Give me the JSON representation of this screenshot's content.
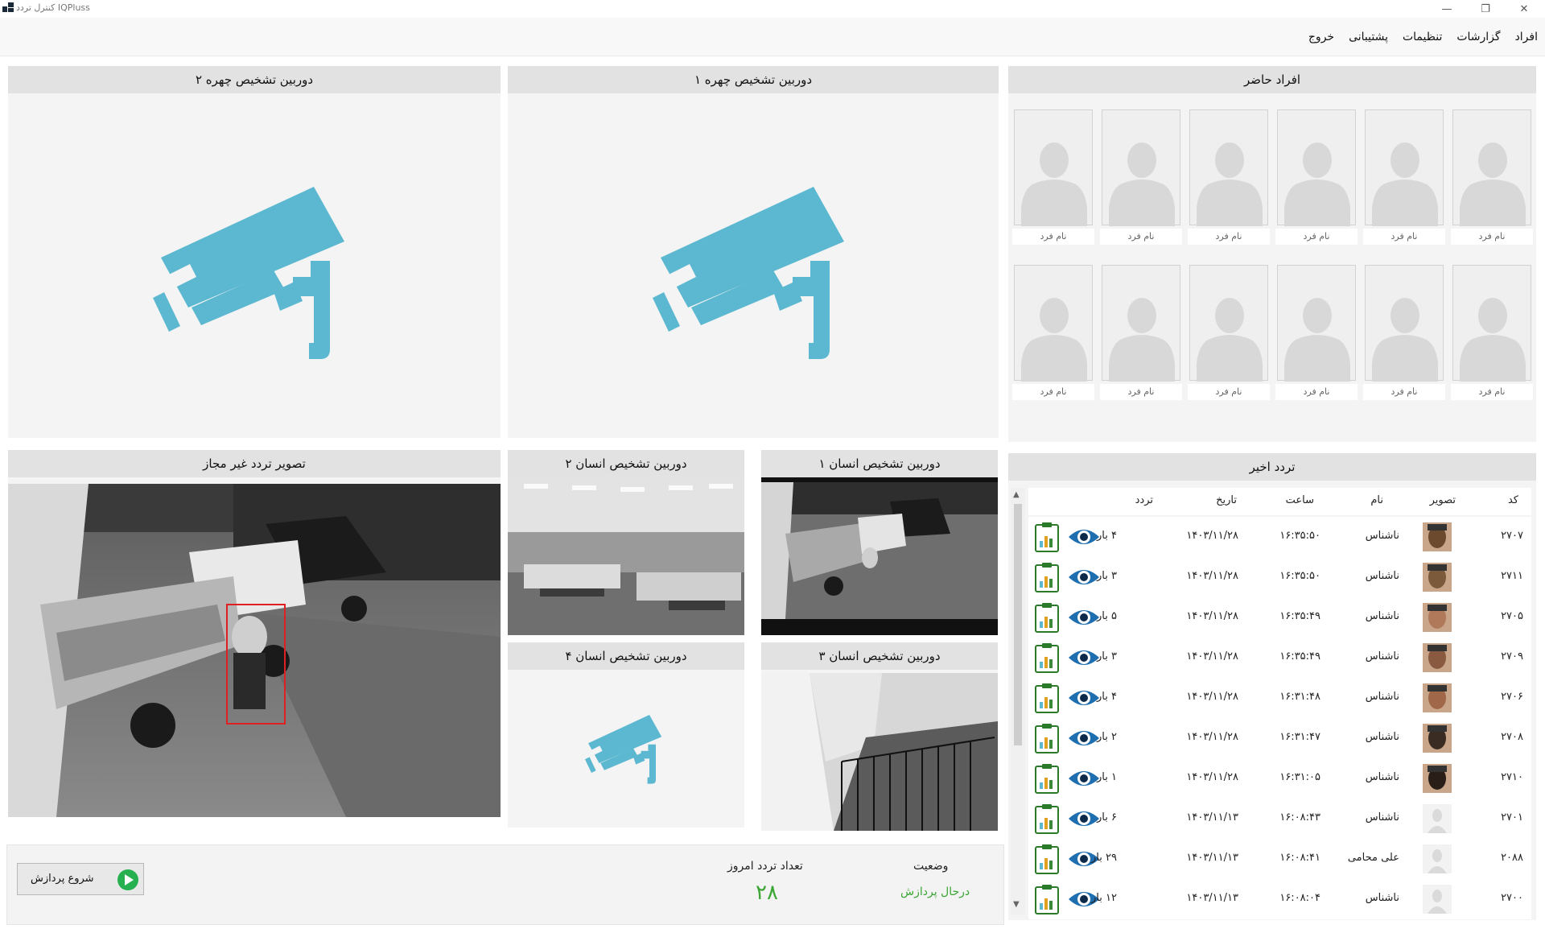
{
  "window": {
    "title": "IQPluss کنترل تردد",
    "minimize_icon": "minimize-icon",
    "restore_icon": "restore-icon",
    "close_icon": "close-icon"
  },
  "menu": {
    "items": [
      "افراد",
      "گزارشات",
      "تنظیمات",
      "پشتیبانی",
      "خروج"
    ]
  },
  "present_people": {
    "title": "افراد حاضر",
    "slots": [
      "نام فرد",
      "نام فرد",
      "نام فرد",
      "نام فرد",
      "نام فرد",
      "نام فرد",
      "نام فرد",
      "نام فرد",
      "نام فرد",
      "نام فرد",
      "نام فرد",
      "نام فرد"
    ]
  },
  "cameras": {
    "face1": "دوربین  تشخیص چهره ۱",
    "face2": "دوربین  تشخیص چهره ۲",
    "unauthorized": "تصویر تردد غیر مجاز",
    "human1": "دوربین تشخیص انسان ۱",
    "human2": "دوربین تشخیص انسان ۲",
    "human3": "دوربین تشخیص انسان ۳",
    "human4": "دوربین تشخیص انسان ۴"
  },
  "recent": {
    "title": "تردد اخیر",
    "columns": {
      "code": "کد",
      "photo": "تصویر",
      "name": "نام",
      "time": "ساعت",
      "date": "تاریخ",
      "count": "تردد"
    },
    "rows": [
      {
        "code": "۲۷۰۷",
        "name": "ناشناس",
        "time": "۱۶:۳۵:۵۰",
        "date": "۱۴۰۳/۱۱/۲۸",
        "count": "۴ بار"
      },
      {
        "code": "۲۷۱۱",
        "name": "ناشناس",
        "time": "۱۶:۳۵:۵۰",
        "date": "۱۴۰۳/۱۱/۲۸",
        "count": "۳ بار"
      },
      {
        "code": "۲۷۰۵",
        "name": "ناشناس",
        "time": "۱۶:۳۵:۴۹",
        "date": "۱۴۰۳/۱۱/۲۸",
        "count": "۵ بار"
      },
      {
        "code": "۲۷۰۹",
        "name": "ناشناس",
        "time": "۱۶:۳۵:۴۹",
        "date": "۱۴۰۳/۱۱/۲۸",
        "count": "۳ بار"
      },
      {
        "code": "۲۷۰۶",
        "name": "ناشناس",
        "time": "۱۶:۳۱:۴۸",
        "date": "۱۴۰۳/۱۱/۲۸",
        "count": "۴ بار"
      },
      {
        "code": "۲۷۰۸",
        "name": "ناشناس",
        "time": "۱۶:۳۱:۴۷",
        "date": "۱۴۰۳/۱۱/۲۸",
        "count": "۲ بار"
      },
      {
        "code": "۲۷۱۰",
        "name": "ناشناس",
        "time": "۱۶:۳۱:۰۵",
        "date": "۱۴۰۳/۱۱/۲۸",
        "count": "۱ بار"
      },
      {
        "code": "۲۷۰۱",
        "name": "ناشناس",
        "time": "۱۶:۰۸:۴۳",
        "date": "۱۴۰۳/۱۱/۱۳",
        "count": "۶ بار"
      },
      {
        "code": "۲۰۸۸",
        "name": "علی محامی",
        "time": "۱۶:۰۸:۴۱",
        "date": "۱۴۰۳/۱۱/۱۳",
        "count": "۲۹ بار"
      },
      {
        "code": "۲۷۰۰",
        "name": "ناشناس",
        "time": "۱۶:۰۸:۰۴",
        "date": "۱۴۰۳/۱۱/۱۳",
        "count": "۱۲ بار"
      }
    ]
  },
  "status": {
    "start_label": "شروع پردازش",
    "today_count_label": "تعداد تردد امروز",
    "today_count": "۲۸",
    "state_label": "وضعیت",
    "state_value": "درحال پردازش",
    "accent": "#3aa533"
  },
  "colors": {
    "camera_icon": "#5bb8d0",
    "header_bg": "#e2e2e2",
    "panel_bg": "#f4f4f4"
  }
}
